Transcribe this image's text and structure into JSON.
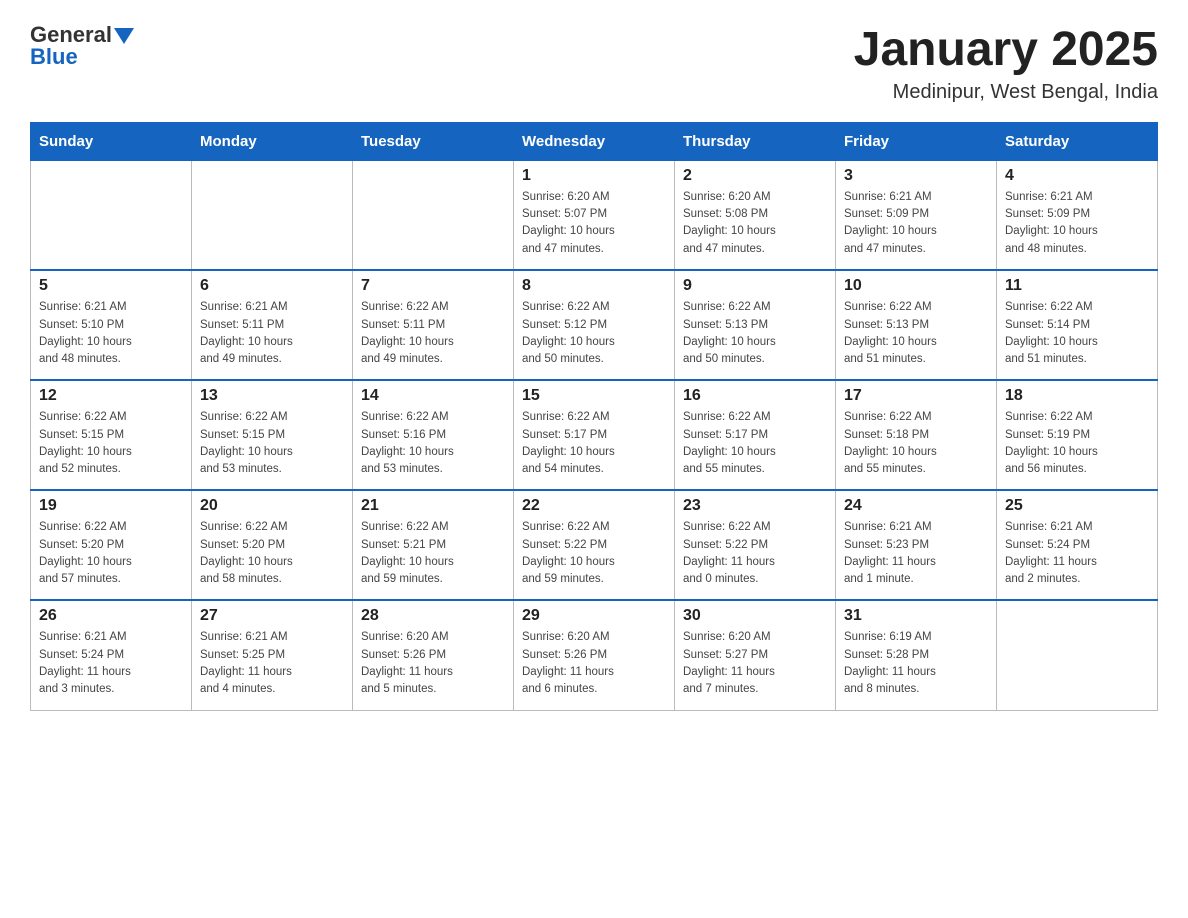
{
  "header": {
    "logo_general": "General",
    "logo_blue": "Blue",
    "title": "January 2025",
    "subtitle": "Medinipur, West Bengal, India"
  },
  "days_of_week": [
    "Sunday",
    "Monday",
    "Tuesday",
    "Wednesday",
    "Thursday",
    "Friday",
    "Saturday"
  ],
  "weeks": [
    [
      {
        "day": "",
        "info": ""
      },
      {
        "day": "",
        "info": ""
      },
      {
        "day": "",
        "info": ""
      },
      {
        "day": "1",
        "info": "Sunrise: 6:20 AM\nSunset: 5:07 PM\nDaylight: 10 hours\nand 47 minutes."
      },
      {
        "day": "2",
        "info": "Sunrise: 6:20 AM\nSunset: 5:08 PM\nDaylight: 10 hours\nand 47 minutes."
      },
      {
        "day": "3",
        "info": "Sunrise: 6:21 AM\nSunset: 5:09 PM\nDaylight: 10 hours\nand 47 minutes."
      },
      {
        "day": "4",
        "info": "Sunrise: 6:21 AM\nSunset: 5:09 PM\nDaylight: 10 hours\nand 48 minutes."
      }
    ],
    [
      {
        "day": "5",
        "info": "Sunrise: 6:21 AM\nSunset: 5:10 PM\nDaylight: 10 hours\nand 48 minutes."
      },
      {
        "day": "6",
        "info": "Sunrise: 6:21 AM\nSunset: 5:11 PM\nDaylight: 10 hours\nand 49 minutes."
      },
      {
        "day": "7",
        "info": "Sunrise: 6:22 AM\nSunset: 5:11 PM\nDaylight: 10 hours\nand 49 minutes."
      },
      {
        "day": "8",
        "info": "Sunrise: 6:22 AM\nSunset: 5:12 PM\nDaylight: 10 hours\nand 50 minutes."
      },
      {
        "day": "9",
        "info": "Sunrise: 6:22 AM\nSunset: 5:13 PM\nDaylight: 10 hours\nand 50 minutes."
      },
      {
        "day": "10",
        "info": "Sunrise: 6:22 AM\nSunset: 5:13 PM\nDaylight: 10 hours\nand 51 minutes."
      },
      {
        "day": "11",
        "info": "Sunrise: 6:22 AM\nSunset: 5:14 PM\nDaylight: 10 hours\nand 51 minutes."
      }
    ],
    [
      {
        "day": "12",
        "info": "Sunrise: 6:22 AM\nSunset: 5:15 PM\nDaylight: 10 hours\nand 52 minutes."
      },
      {
        "day": "13",
        "info": "Sunrise: 6:22 AM\nSunset: 5:15 PM\nDaylight: 10 hours\nand 53 minutes."
      },
      {
        "day": "14",
        "info": "Sunrise: 6:22 AM\nSunset: 5:16 PM\nDaylight: 10 hours\nand 53 minutes."
      },
      {
        "day": "15",
        "info": "Sunrise: 6:22 AM\nSunset: 5:17 PM\nDaylight: 10 hours\nand 54 minutes."
      },
      {
        "day": "16",
        "info": "Sunrise: 6:22 AM\nSunset: 5:17 PM\nDaylight: 10 hours\nand 55 minutes."
      },
      {
        "day": "17",
        "info": "Sunrise: 6:22 AM\nSunset: 5:18 PM\nDaylight: 10 hours\nand 55 minutes."
      },
      {
        "day": "18",
        "info": "Sunrise: 6:22 AM\nSunset: 5:19 PM\nDaylight: 10 hours\nand 56 minutes."
      }
    ],
    [
      {
        "day": "19",
        "info": "Sunrise: 6:22 AM\nSunset: 5:20 PM\nDaylight: 10 hours\nand 57 minutes."
      },
      {
        "day": "20",
        "info": "Sunrise: 6:22 AM\nSunset: 5:20 PM\nDaylight: 10 hours\nand 58 minutes."
      },
      {
        "day": "21",
        "info": "Sunrise: 6:22 AM\nSunset: 5:21 PM\nDaylight: 10 hours\nand 59 minutes."
      },
      {
        "day": "22",
        "info": "Sunrise: 6:22 AM\nSunset: 5:22 PM\nDaylight: 10 hours\nand 59 minutes."
      },
      {
        "day": "23",
        "info": "Sunrise: 6:22 AM\nSunset: 5:22 PM\nDaylight: 11 hours\nand 0 minutes."
      },
      {
        "day": "24",
        "info": "Sunrise: 6:21 AM\nSunset: 5:23 PM\nDaylight: 11 hours\nand 1 minute."
      },
      {
        "day": "25",
        "info": "Sunrise: 6:21 AM\nSunset: 5:24 PM\nDaylight: 11 hours\nand 2 minutes."
      }
    ],
    [
      {
        "day": "26",
        "info": "Sunrise: 6:21 AM\nSunset: 5:24 PM\nDaylight: 11 hours\nand 3 minutes."
      },
      {
        "day": "27",
        "info": "Sunrise: 6:21 AM\nSunset: 5:25 PM\nDaylight: 11 hours\nand 4 minutes."
      },
      {
        "day": "28",
        "info": "Sunrise: 6:20 AM\nSunset: 5:26 PM\nDaylight: 11 hours\nand 5 minutes."
      },
      {
        "day": "29",
        "info": "Sunrise: 6:20 AM\nSunset: 5:26 PM\nDaylight: 11 hours\nand 6 minutes."
      },
      {
        "day": "30",
        "info": "Sunrise: 6:20 AM\nSunset: 5:27 PM\nDaylight: 11 hours\nand 7 minutes."
      },
      {
        "day": "31",
        "info": "Sunrise: 6:19 AM\nSunset: 5:28 PM\nDaylight: 11 hours\nand 8 minutes."
      },
      {
        "day": "",
        "info": ""
      }
    ]
  ]
}
